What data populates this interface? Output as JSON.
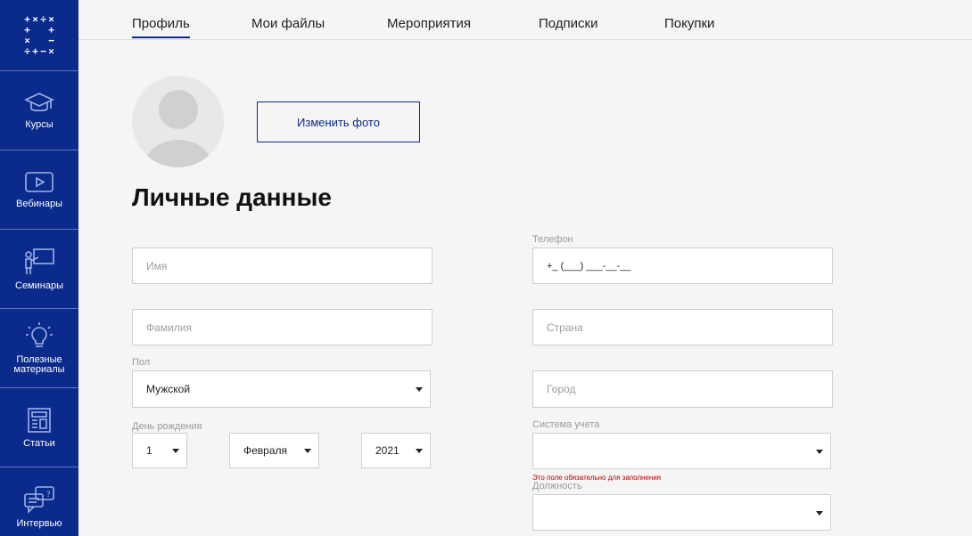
{
  "sidebar": {
    "logo_symbols": [
      "+",
      "×",
      "÷",
      "×",
      "+",
      "",
      "",
      "+",
      "×",
      "",
      "",
      "−",
      "÷",
      "+",
      "−",
      "×"
    ],
    "items": [
      {
        "label": "Курсы",
        "icon": "graduation-cap-icon"
      },
      {
        "label": "Вебинары",
        "icon": "video-play-icon"
      },
      {
        "label": "Семинары",
        "icon": "presenter-board-icon"
      },
      {
        "label": "Полезные материалы",
        "icon": "lightbulb-icon"
      },
      {
        "label": "Статьи",
        "icon": "newspaper-icon"
      },
      {
        "label": "Интервью",
        "icon": "chat-bubbles-icon"
      }
    ]
  },
  "tabs": [
    {
      "label": "Профиль",
      "active": true
    },
    {
      "label": "Мои файлы",
      "active": false
    },
    {
      "label": "Мероприятия",
      "active": false
    },
    {
      "label": "Подписки",
      "active": false
    },
    {
      "label": "Покупки",
      "active": false
    }
  ],
  "profile": {
    "change_photo_label": "Изменить фото",
    "section_title": "Личные данные"
  },
  "form": {
    "first_name": {
      "placeholder": "Имя"
    },
    "last_name": {
      "placeholder": "Фамилия"
    },
    "gender": {
      "label": "Пол",
      "value": "Мужской"
    },
    "birthday": {
      "label": "День рождения",
      "day": "1",
      "month": "Февраля",
      "year": "2021"
    },
    "phone": {
      "label": "Телефон",
      "placeholder": "+_ (___) ___-__-__"
    },
    "country": {
      "placeholder": "Страна"
    },
    "city": {
      "placeholder": "Город"
    },
    "accounting_system": {
      "label": "Система учета",
      "value": "",
      "error": "Это поле обязательно для заполнения"
    },
    "position": {
      "label": "Должность",
      "value": ""
    }
  },
  "colors": {
    "brand": "#0a2a8c",
    "error": "#b30000"
  }
}
